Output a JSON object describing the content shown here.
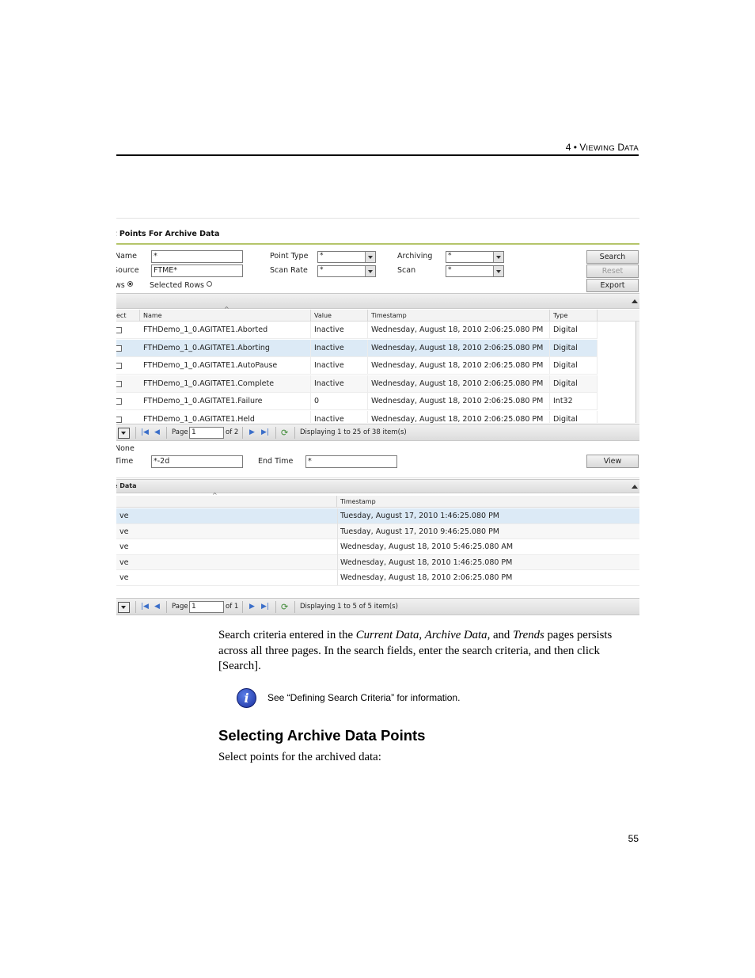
{
  "header": {
    "chapter_num": "4 •",
    "chapter_first": "V",
    "chapter_rest": "IEWING",
    "chapter_first2": "D",
    "chapter_rest2": "ATA"
  },
  "screenshot": {
    "panel_title": "t Points For Archive Data",
    "filters": {
      "name_label": "Name",
      "name_value": "*",
      "source_label": "Source",
      "source_value": "FTME*",
      "rows_label": "ws",
      "selected_rows_label": "Selected Rows",
      "point_type_label": "Point Type",
      "point_type_value": "*",
      "scan_rate_label": "Scan Rate",
      "scan_rate_value": "*",
      "archiving_label": "Archiving",
      "archiving_value": "*",
      "scan_label": "Scan",
      "scan_value": "*"
    },
    "buttons": {
      "search": "Search",
      "reset": "Reset",
      "export": "Export",
      "view": "View"
    },
    "points_grid": {
      "columns": [
        "ect",
        "Name",
        "Value",
        "Timestamp",
        "Type"
      ],
      "rows": [
        {
          "name": "FTHDemo_1_0.AGITATE1.Aborted",
          "value": "Inactive",
          "timestamp": "Wednesday, August 18, 2010 2:06:25.080 PM",
          "type": "Digital"
        },
        {
          "name": "FTHDemo_1_0.AGITATE1.Aborting",
          "value": "Inactive",
          "timestamp": "Wednesday, August 18, 2010 2:06:25.080 PM",
          "type": "Digital"
        },
        {
          "name": "FTHDemo_1_0.AGITATE1.AutoPause",
          "value": "Inactive",
          "timestamp": "Wednesday, August 18, 2010 2:06:25.080 PM",
          "type": "Digital"
        },
        {
          "name": "FTHDemo_1_0.AGITATE1.Complete",
          "value": "Inactive",
          "timestamp": "Wednesday, August 18, 2010 2:06:25.080 PM",
          "type": "Digital"
        },
        {
          "name": "FTHDemo_1_0.AGITATE1.Failure",
          "value": "0",
          "timestamp": "Wednesday, August 18, 2010 2:06:25.080 PM",
          "type": "Int32"
        },
        {
          "name": "FTHDemo_1_0.AGITATE1.Held",
          "value": "Inactive",
          "timestamp": "Wednesday, August 18, 2010 2:06:25.080 PM",
          "type": "Digital"
        }
      ]
    },
    "pager1": {
      "page_label": "Page",
      "page_value": "1",
      "of_label": "of 2",
      "display": "Displaying 1 to 25 of 38 item(s)"
    },
    "time_filter": {
      "none_label": "None",
      "start_label": "Time",
      "start_value": "*-2d",
      "end_label": "End Time",
      "end_value": "*"
    },
    "archive_panel_title": "e Data",
    "archive_grid": {
      "columns": [
        "",
        "Timestamp"
      ],
      "rows": [
        {
          "value": "ve",
          "timestamp": "Tuesday, August 17, 2010 1:46:25.080 PM"
        },
        {
          "value": "ve",
          "timestamp": "Tuesday, August 17, 2010 9:46:25.080 PM"
        },
        {
          "value": "ve",
          "timestamp": "Wednesday, August 18, 2010 5:46:25.080 AM"
        },
        {
          "value": "ve",
          "timestamp": "Wednesday, August 18, 2010 1:46:25.080 PM"
        },
        {
          "value": "ve",
          "timestamp": "Wednesday, August 18, 2010 2:06:25.080 PM"
        }
      ]
    },
    "pager2": {
      "page_label": "Page",
      "page_value": "1",
      "of_label": "of 1",
      "display": "Displaying 1 to 5 of 5 item(s)"
    }
  },
  "body": {
    "p1_a": "Search criteria entered in the ",
    "p1_cur": "Current Data",
    "p1_b": ", ",
    "p1_arc": "Archive Data",
    "p1_c": ", and ",
    "p1_trends": "Trends",
    "p1_d": " pages persists across all three pages. In the search fields, enter the search criteria, and then click [Search].",
    "note_icon_letter": "i",
    "note": "See “Defining Search Criteria” for information.",
    "heading": "Selecting Archive Data Points",
    "p2": "Select points for the archived data:"
  },
  "footer": {
    "page_number": "55"
  }
}
